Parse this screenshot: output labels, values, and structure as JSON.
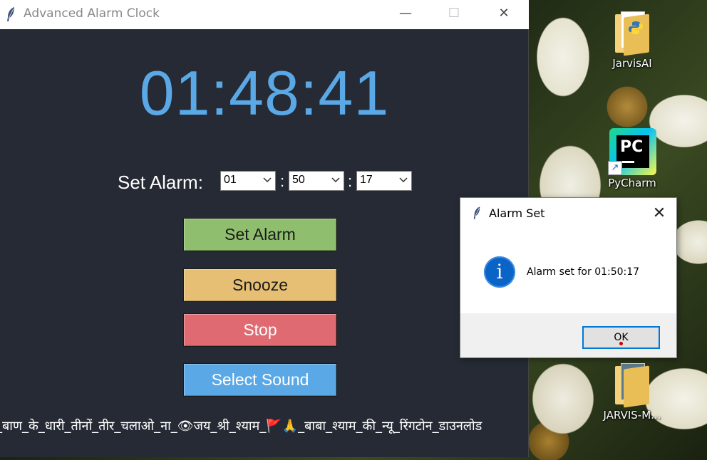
{
  "app_window": {
    "title": "Advanced Alarm Clock",
    "controls": {
      "minimize": "—",
      "maximize": "☐",
      "close": "✕"
    },
    "current_time": "01:48:41",
    "alarm": {
      "label": "Set Alarm:",
      "hour": "01",
      "minute": "50",
      "second": "17",
      "separator": ":"
    },
    "buttons": {
      "set_alarm": "Set Alarm",
      "snooze": "Snooze",
      "stop": "Stop",
      "select_sound": "Select Sound"
    },
    "song_ticker": "_बाण_के_धारी_तीनों_तीर_चलाओ_ना_👁जय_श्री_श्याम_🚩🙏_बाबा_श्याम_की_न्यू_रिंगटोन_डाउनलोड",
    "colors": {
      "background": "#252a34",
      "clock": "#5aa8e6",
      "set_alarm": "#8fbf6e",
      "snooze": "#e6bf74",
      "stop": "#e06a72",
      "select_sound": "#5aa8e6"
    }
  },
  "dialog": {
    "title": "Alarm Set",
    "close": "✕",
    "icon": "info-icon",
    "icon_glyph": "i",
    "message": "Alarm set for 01:50:17",
    "ok_label": "OK"
  },
  "desktop": {
    "icons": [
      {
        "label": "JarvisAI",
        "icon": "python-folder-icon"
      },
      {
        "label": "PyCharm",
        "icon": "pycharm-icon"
      },
      {
        "label": "JARVIS-M...",
        "icon": "folder-icon"
      }
    ]
  }
}
